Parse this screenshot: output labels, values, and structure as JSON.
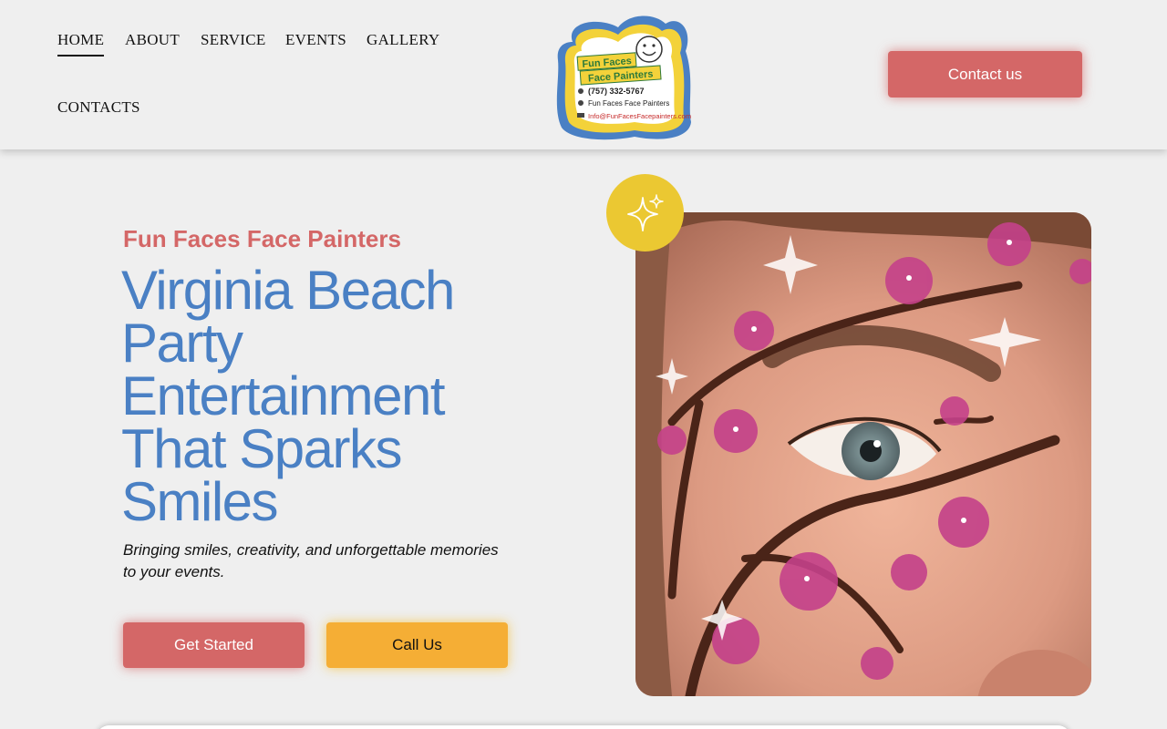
{
  "nav": {
    "items": [
      {
        "label": "HOME",
        "active": true
      },
      {
        "label": "ABOUT",
        "active": false
      },
      {
        "label": "SERVICE",
        "active": false
      },
      {
        "label": "EVENTS",
        "active": false
      },
      {
        "label": "GALLERY",
        "active": false
      },
      {
        "label": "CONTACTS",
        "active": false
      }
    ]
  },
  "logo": {
    "line1": "Fun Faces",
    "line2": "Face Painters",
    "phone": "(757) 332-5767",
    "facebook": "Fun Faces Face Painters",
    "email": "Info@FunFacesFacepainters.com",
    "icon": "smiley-face-icon"
  },
  "header": {
    "contact_label": "Contact us"
  },
  "hero": {
    "eyebrow": "Fun Faces Face Painters",
    "headline": "Virginia Beach Party Entertainment That Sparks Smiles",
    "tagline": "Bringing smiles, creativity, and unforgettable memories to your events.",
    "primary_cta": "Get Started",
    "secondary_cta": "Call Us",
    "badge_icon": "sparkle-icon",
    "photo_subject": "face-paint-cherry-blossom-photo"
  },
  "colors": {
    "accent_red": "#d46767",
    "accent_blue": "#4a80c4",
    "accent_yellow": "#f5ae35",
    "badge_yellow": "#ebc832",
    "background": "#efefef"
  }
}
